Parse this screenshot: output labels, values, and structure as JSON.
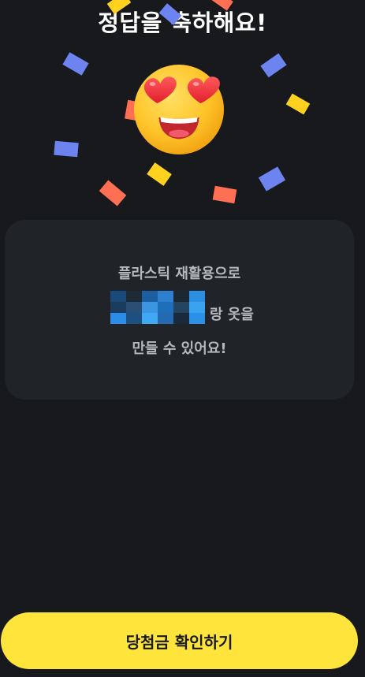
{
  "header": {
    "title": "정답을 축하해요!"
  },
  "celebration": {
    "emoji_icon": "heart-eyes-emoji-icon",
    "confetti_colors": [
      "#6c83f0",
      "#ffd21f",
      "#ff6f54"
    ]
  },
  "result_card": {
    "line1": "플라스틱 재활용으로",
    "line2_redacted_word": "(blurred)",
    "line2_suffix": "랑 옷을",
    "line3": "만들 수 있어요!"
  },
  "footer": {
    "confirm_button_label": "당첨금 확인하기",
    "button_color": "#ffe53b"
  }
}
